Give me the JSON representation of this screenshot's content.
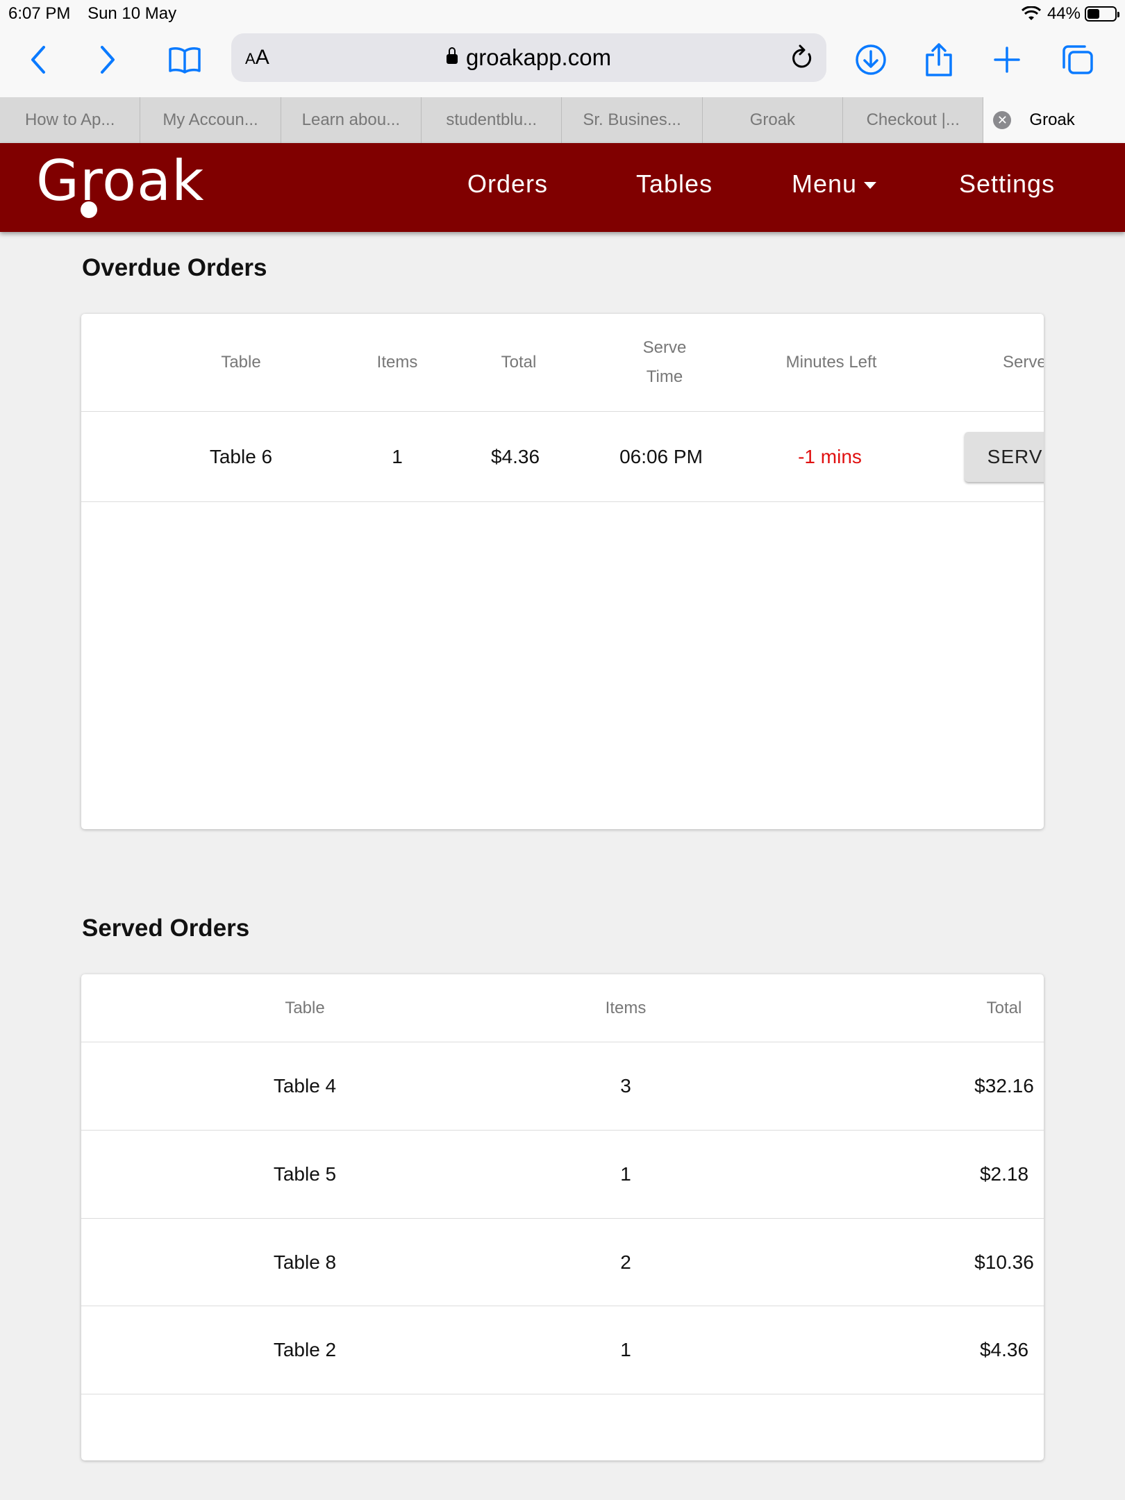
{
  "status_bar": {
    "time": "6:07 PM",
    "date": "Sun 10 May",
    "battery": "44%",
    "battery_level": 0.44
  },
  "browser": {
    "url": "groakapp.com",
    "aa_small": "A",
    "aa_big": "A",
    "icons": [
      "back-icon",
      "forward-icon",
      "bookmarks-icon",
      "reload-icon",
      "download-icon",
      "share-icon",
      "new-tab-icon",
      "tabs-icon"
    ],
    "accent_color": "#0a7aff",
    "tabs": [
      {
        "label": "How to Ap..."
      },
      {
        "label": "My Accoun..."
      },
      {
        "label": "Learn abou..."
      },
      {
        "label": "studentblu..."
      },
      {
        "label": "Sr. Busines..."
      },
      {
        "label": "Groak"
      },
      {
        "label": "Checkout |..."
      },
      {
        "label": "Groak",
        "active": true
      }
    ]
  },
  "navbar": {
    "brand": "Groak",
    "brand_color": "#800000",
    "items": {
      "orders": "Orders",
      "tables": "Tables",
      "menu": "Menu",
      "settings": "Settings"
    }
  },
  "overdue": {
    "title": "Overdue Orders",
    "headers": {
      "table": "Table",
      "items": "Items",
      "total": "Total",
      "serve_time_1": "Serve",
      "serve_time_2": "Time",
      "minutes_left": "Minutes Left",
      "served": "Served"
    },
    "rows": [
      {
        "table": "Table 6",
        "items": "1",
        "total": "$4.36",
        "serve_time": "06:06 PM",
        "minutes_left": "-1 mins",
        "action": "SERVED"
      }
    ]
  },
  "served": {
    "title": "Served Orders",
    "headers": {
      "table": "Table",
      "items": "Items",
      "total": "Total"
    },
    "rows": [
      {
        "table": "Table 4",
        "items": "3",
        "total": "$32.16"
      },
      {
        "table": "Table 5",
        "items": "1",
        "total": "$2.18"
      },
      {
        "table": "Table 8",
        "items": "2",
        "total": "$10.36"
      },
      {
        "table": "Table 2",
        "items": "1",
        "total": "$4.36"
      }
    ]
  }
}
